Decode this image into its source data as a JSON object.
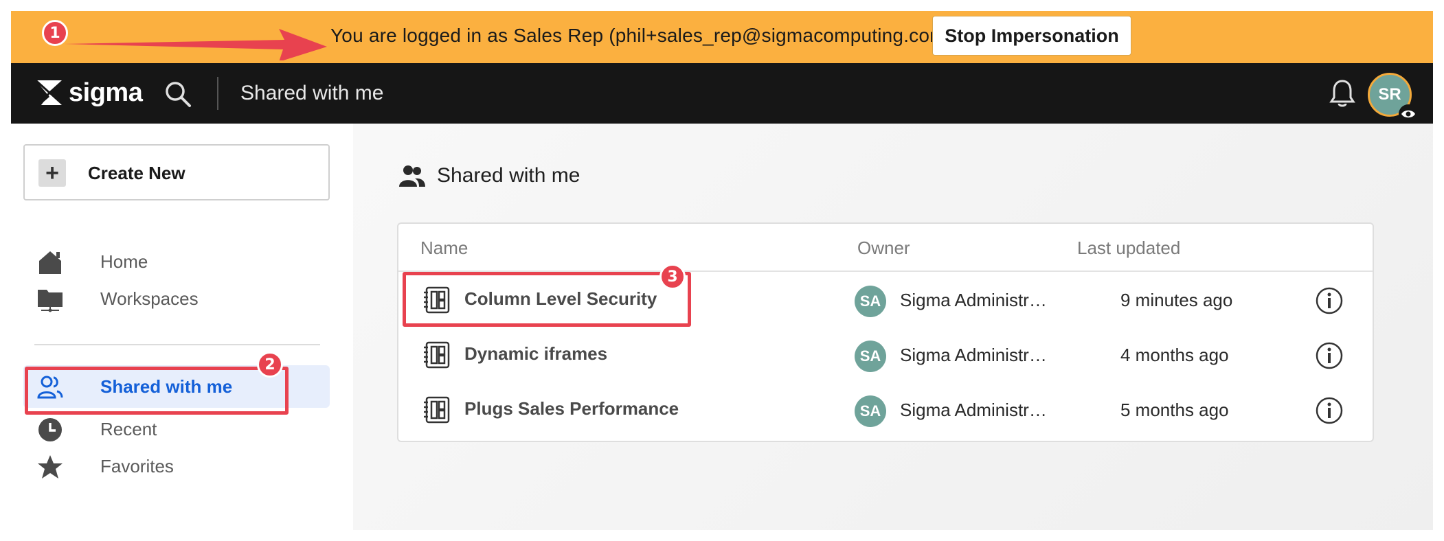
{
  "banner": {
    "message": "You are logged in as Sales Rep (phil+sales_rep@sigmacomputing.com)",
    "stop_button": "Stop Impersonation",
    "background": "#fbb040"
  },
  "topbar": {
    "logo_text": "sigma",
    "title": "Shared with me",
    "avatar_initials": "SR",
    "icons": [
      "sigma-logo-icon",
      "search-icon",
      "bell-icon",
      "eye-icon"
    ]
  },
  "sidebar": {
    "create_new": "Create New",
    "items": [
      {
        "label": "Home",
        "icon": "home-icon",
        "active": false
      },
      {
        "label": "Workspaces",
        "icon": "folder-icon",
        "active": false
      },
      {
        "label": "Shared with me",
        "icon": "people-icon",
        "active": true
      },
      {
        "label": "Recent",
        "icon": "clock-icon",
        "active": false
      },
      {
        "label": "Favorites",
        "icon": "star-icon",
        "active": false
      }
    ]
  },
  "main": {
    "title": "Shared with me",
    "columns": [
      "Name",
      "Owner",
      "Last updated"
    ],
    "rows": [
      {
        "name": "Column Level Security",
        "owner_initials": "SA",
        "owner": "Sigma Administrator",
        "updated": "9 minutes ago"
      },
      {
        "name": "Dynamic iframes",
        "owner_initials": "SA",
        "owner": "Sigma Administrator",
        "updated": "4 months ago"
      },
      {
        "name": "Plugs Sales Performance",
        "owner_initials": "SA",
        "owner": "Sigma Administrator",
        "updated": "5 months ago"
      }
    ]
  },
  "annotations": {
    "badge_1": "1",
    "badge_2": "2",
    "badge_3": "3",
    "color": "#e8424f"
  },
  "colors": {
    "accent_blue": "#1460d8",
    "avatar_green": "#6fa39a",
    "topbar_bg": "#161616"
  }
}
